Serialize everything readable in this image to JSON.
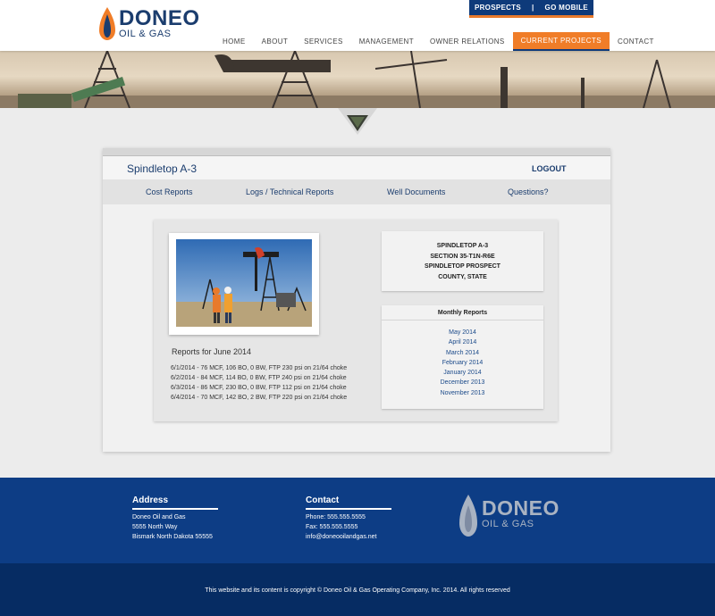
{
  "brand": {
    "name": "DONEO",
    "sub": "OIL & GAS"
  },
  "topbar": {
    "prospects": "PROSPECTS",
    "separator": "|",
    "mobile": "GO MOBILE"
  },
  "nav": [
    {
      "label": "HOME",
      "active": false
    },
    {
      "label": "ABOUT",
      "active": false
    },
    {
      "label": "SERVICES",
      "active": false
    },
    {
      "label": "MANAGEMENT",
      "active": false
    },
    {
      "label": "OWNER RELATIONS",
      "active": false
    },
    {
      "label": "CURRENT PROJECTS",
      "active": true
    },
    {
      "label": "CONTACT",
      "active": false
    }
  ],
  "panel": {
    "title": "Spindletop A-3",
    "logout": "LOGOUT",
    "subnav": [
      "Cost Reports",
      "Logs / Technical Reports",
      "Well Documents",
      "Questions?"
    ]
  },
  "reports": {
    "title": "Reports for June 2014",
    "lines": [
      "6/1/2014 - 76 MCF, 106 BO, 0 BW, FTP 230 psi on 21/64 choke",
      "6/2/2014 - 84 MCF, 114 BO, 0 BW, FTP 240 psi on 21/64 choke",
      "6/3/2014 - 86 MCF, 230 BO, 0 BW, FTP 112 psi on 21/64 choke",
      "6/4/2014 - 70 MCF, 142 BO, 2 BW, FTP 220 psi on 21/64 choke"
    ]
  },
  "info": [
    "SPINDLETOP A-3",
    "SECTION 35-T1N-R6E",
    "SPINDLETOP PROSPECT",
    "COUNTY, STATE"
  ],
  "monthly": {
    "title": "Monthly Reports",
    "items": [
      "May 2014",
      "April 2014",
      "March 2014",
      "February 2014",
      "January 2014",
      "December 2013",
      "November 2013"
    ]
  },
  "footer": {
    "address_title": "Address",
    "address": [
      "Doneo Oil and Gas",
      "5555 North Way",
      "Bismark North Dakota 55555"
    ],
    "contact_title": "Contact",
    "contact": [
      "Phone: 555.555.5555",
      "Fax: 555.555.5555",
      "info@doneooilandgas.net"
    ],
    "copyright": "This website and its content is copyright © Doneo Oil & Gas Operating Company, Inc. 2014. All rights reserved"
  },
  "colors": {
    "navy": "#0e3a7a",
    "orange": "#f07d28",
    "link": "#1b4a8a"
  }
}
